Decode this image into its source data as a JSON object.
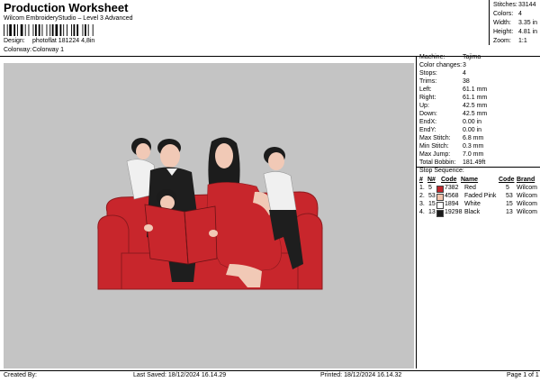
{
  "header": {
    "title": "Production Worksheet",
    "subtitle": "Wilcom EmbroideryStudio – Level 3 Advanced",
    "design_label": "Design:",
    "design_value": "photoflat 181224 4,8in",
    "colorway_label": "Colorway:",
    "colorway_value": "Colorway 1"
  },
  "stats": [
    {
      "label": "Stitches:",
      "value": "33144"
    },
    {
      "label": "Colors:",
      "value": "4"
    },
    {
      "label": "Width:",
      "value": "3.35 in"
    },
    {
      "label": "Height:",
      "value": "4.81 in"
    },
    {
      "label": "Zoom:",
      "value": "1:1"
    }
  ],
  "specs": [
    {
      "label": "Machine:",
      "value": "Tajima"
    },
    {
      "label": "Color changes:",
      "value": "3"
    },
    {
      "label": "Stops:",
      "value": "4"
    },
    {
      "label": "Trims:",
      "value": "38"
    },
    {
      "label": "Left:",
      "value": "61.1 mm"
    },
    {
      "label": "Right:",
      "value": "61.1 mm"
    },
    {
      "label": "Up:",
      "value": "42.5 mm"
    },
    {
      "label": "Down:",
      "value": "42.5 mm"
    },
    {
      "label": "EndX:",
      "value": "0.00 in"
    },
    {
      "label": "EndY:",
      "value": "0.00 in"
    },
    {
      "label": "Max Stitch:",
      "value": "6.8 mm"
    },
    {
      "label": "Min Stitch:",
      "value": "0.3 mm"
    },
    {
      "label": "Max Jump:",
      "value": "7.0 mm"
    },
    {
      "label": "Total Bobbin:",
      "value": "181.49ft"
    }
  ],
  "sequence": {
    "title": "Stop Sequence:",
    "headers": [
      "#",
      "N#",
      "Code",
      "Name",
      "Code",
      "Brand"
    ],
    "rows": [
      {
        "index": "1.",
        "needle": "5",
        "stitches": "7382",
        "name": "Red",
        "code": "5",
        "brand": "Wilcom",
        "color": "#c0262b"
      },
      {
        "index": "2.",
        "needle": "53",
        "stitches": "4568",
        "name": "Faded Pink",
        "code": "53",
        "brand": "Wilcom",
        "color": "#f3c5ad"
      },
      {
        "index": "3.",
        "needle": "15",
        "stitches": "1894",
        "name": "White",
        "code": "15",
        "brand": "Wilcom",
        "color": "#ffffff"
      },
      {
        "index": "4.",
        "needle": "13",
        "stitches": "19298",
        "name": "Black",
        "code": "13",
        "brand": "Wilcom",
        "color": "#1a1a1a"
      }
    ]
  },
  "footer": {
    "created_by": "Created By:",
    "last_saved": "Last Saved: 18/12/2024 16.14.29",
    "printed": "Printed: 18/12/2024 16.14.32",
    "page": "Page 1 of 1"
  },
  "colors": {
    "background_panel": "#c4c4c4",
    "sofa": "#c8262c",
    "skin": "#f1c9b6",
    "hair": "#1c1c1c",
    "shirt_white": "#f0f0f0"
  }
}
